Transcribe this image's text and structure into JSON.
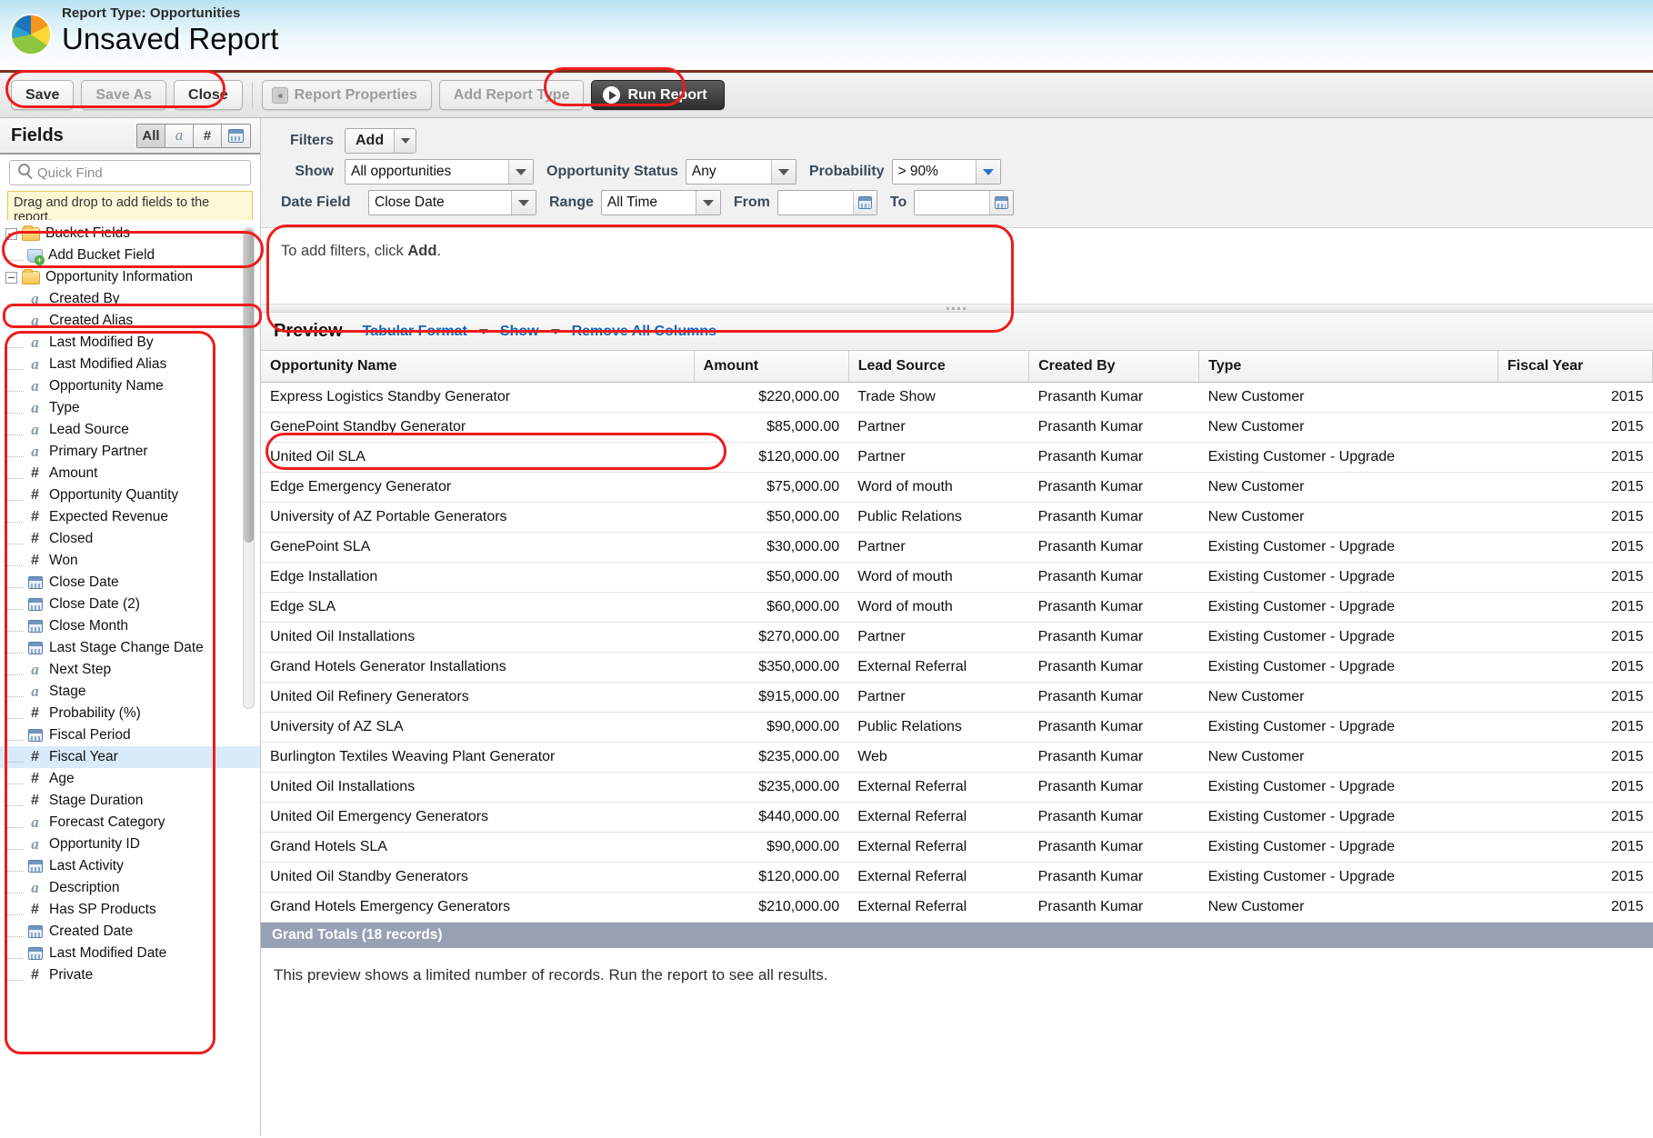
{
  "header": {
    "report_type_label": "Report Type: Opportunities",
    "report_name": "Unsaved Report",
    "logo_icon": "pie-chart-logo"
  },
  "toolbar": {
    "save": "Save",
    "save_as": "Save As",
    "close": "Close",
    "report_properties": "Report Properties",
    "add_report_type": "Add Report Type",
    "run_report": "Run Report"
  },
  "fields_panel": {
    "title": "Fields",
    "type_filters": [
      {
        "name": "all",
        "label": "All",
        "selected": true
      },
      {
        "name": "text",
        "label": "a",
        "selected": false
      },
      {
        "name": "number",
        "label": "#",
        "selected": false
      },
      {
        "name": "date",
        "label": "",
        "selected": false
      }
    ],
    "quick_find_placeholder": "Quick Find",
    "quick_find_value": "",
    "drag_hint": "Drag and drop to add fields to the report.",
    "tree": [
      {
        "type": "group",
        "label": "Bucket Fields",
        "expanded": true
      },
      {
        "type": "bucket",
        "label": "Add Bucket Field"
      },
      {
        "type": "group",
        "label": "Opportunity Information",
        "expanded": true
      },
      {
        "type": "field",
        "icon": "text",
        "label": "Created By"
      },
      {
        "type": "field",
        "icon": "text",
        "label": "Created Alias"
      },
      {
        "type": "field",
        "icon": "text",
        "label": "Last Modified By"
      },
      {
        "type": "field",
        "icon": "text",
        "label": "Last Modified Alias"
      },
      {
        "type": "field",
        "icon": "text",
        "label": "Opportunity Name"
      },
      {
        "type": "field",
        "icon": "text",
        "label": "Type"
      },
      {
        "type": "field",
        "icon": "text",
        "label": "Lead Source"
      },
      {
        "type": "field",
        "icon": "text",
        "label": "Primary Partner"
      },
      {
        "type": "field",
        "icon": "number",
        "label": "Amount"
      },
      {
        "type": "field",
        "icon": "number",
        "label": "Opportunity Quantity"
      },
      {
        "type": "field",
        "icon": "number",
        "label": "Expected Revenue"
      },
      {
        "type": "field",
        "icon": "number",
        "label": "Closed"
      },
      {
        "type": "field",
        "icon": "number",
        "label": "Won"
      },
      {
        "type": "field",
        "icon": "date",
        "label": "Close Date"
      },
      {
        "type": "field",
        "icon": "date",
        "label": "Close Date (2)"
      },
      {
        "type": "field",
        "icon": "date",
        "label": "Close Month"
      },
      {
        "type": "field",
        "icon": "date",
        "label": "Last Stage Change Date"
      },
      {
        "type": "field",
        "icon": "text",
        "label": "Next Step"
      },
      {
        "type": "field",
        "icon": "text",
        "label": "Stage"
      },
      {
        "type": "field",
        "icon": "number",
        "label": "Probability (%)"
      },
      {
        "type": "field",
        "icon": "date",
        "label": "Fiscal Period"
      },
      {
        "type": "field",
        "icon": "number",
        "label": "Fiscal Year",
        "selected": true
      },
      {
        "type": "field",
        "icon": "number",
        "label": "Age"
      },
      {
        "type": "field",
        "icon": "number",
        "label": "Stage Duration"
      },
      {
        "type": "field",
        "icon": "text",
        "label": "Forecast Category"
      },
      {
        "type": "field",
        "icon": "text",
        "label": "Opportunity ID"
      },
      {
        "type": "field",
        "icon": "date",
        "label": "Last Activity"
      },
      {
        "type": "field",
        "icon": "text",
        "label": "Description"
      },
      {
        "type": "field",
        "icon": "number",
        "label": "Has SP Products"
      },
      {
        "type": "field",
        "icon": "date",
        "label": "Created Date"
      },
      {
        "type": "field",
        "icon": "date",
        "label": "Last Modified Date"
      },
      {
        "type": "field",
        "icon": "number",
        "label": "Private"
      }
    ]
  },
  "filters": {
    "filters_label": "Filters",
    "add_button": "Add",
    "show_label": "Show",
    "show_value": "All opportunities",
    "opportunity_status_label": "Opportunity Status",
    "opportunity_status_value": "Any",
    "probability_label": "Probability",
    "probability_value": "> 90%",
    "date_field_label": "Date Field",
    "date_field_value": "Close Date",
    "range_label": "Range",
    "range_value": "All Time",
    "from_label": "From",
    "from_value": "",
    "to_label": "To",
    "to_value": "",
    "empty_note_prefix": "To add filters, click ",
    "empty_note_bold": "Add",
    "empty_note_suffix": "."
  },
  "preview": {
    "title": "Preview",
    "format_link": "Tabular Format",
    "show_link": "Show",
    "remove_all_link": "Remove All Columns",
    "columns": [
      "Opportunity Name",
      "Amount",
      "Lead Source",
      "Created By",
      "Type",
      "Fiscal Year"
    ],
    "rows": [
      [
        "Express Logistics Standby Generator",
        "$220,000.00",
        "Trade Show",
        "Prasanth Kumar",
        "New Customer",
        "2015"
      ],
      [
        "GenePoint Standby Generator",
        "$85,000.00",
        "Partner",
        "Prasanth Kumar",
        "New Customer",
        "2015"
      ],
      [
        "United Oil SLA",
        "$120,000.00",
        "Partner",
        "Prasanth Kumar",
        "Existing Customer - Upgrade",
        "2015"
      ],
      [
        "Edge Emergency Generator",
        "$75,000.00",
        "Word of mouth",
        "Prasanth Kumar",
        "New Customer",
        "2015"
      ],
      [
        "University of AZ Portable Generators",
        "$50,000.00",
        "Public Relations",
        "Prasanth Kumar",
        "New Customer",
        "2015"
      ],
      [
        "GenePoint SLA",
        "$30,000.00",
        "Partner",
        "Prasanth Kumar",
        "Existing Customer - Upgrade",
        "2015"
      ],
      [
        "Edge Installation",
        "$50,000.00",
        "Word of mouth",
        "Prasanth Kumar",
        "Existing Customer - Upgrade",
        "2015"
      ],
      [
        "Edge SLA",
        "$60,000.00",
        "Word of mouth",
        "Prasanth Kumar",
        "Existing Customer - Upgrade",
        "2015"
      ],
      [
        "United Oil Installations",
        "$270,000.00",
        "Partner",
        "Prasanth Kumar",
        "Existing Customer - Upgrade",
        "2015"
      ],
      [
        "Grand Hotels Generator Installations",
        "$350,000.00",
        "External Referral",
        "Prasanth Kumar",
        "Existing Customer - Upgrade",
        "2015"
      ],
      [
        "United Oil Refinery Generators",
        "$915,000.00",
        "Partner",
        "Prasanth Kumar",
        "New Customer",
        "2015"
      ],
      [
        "University of AZ SLA",
        "$90,000.00",
        "Public Relations",
        "Prasanth Kumar",
        "Existing Customer - Upgrade",
        "2015"
      ],
      [
        "Burlington Textiles Weaving Plant Generator",
        "$235,000.00",
        "Web",
        "Prasanth Kumar",
        "New Customer",
        "2015"
      ],
      [
        "United Oil Installations",
        "$235,000.00",
        "External Referral",
        "Prasanth Kumar",
        "Existing Customer - Upgrade",
        "2015"
      ],
      [
        "United Oil Emergency Generators",
        "$440,000.00",
        "External Referral",
        "Prasanth Kumar",
        "Existing Customer - Upgrade",
        "2015"
      ],
      [
        "Grand Hotels SLA",
        "$90,000.00",
        "External Referral",
        "Prasanth Kumar",
        "Existing Customer - Upgrade",
        "2015"
      ],
      [
        "United Oil Standby Generators",
        "$120,000.00",
        "External Referral",
        "Prasanth Kumar",
        "Existing Customer - Upgrade",
        "2015"
      ],
      [
        "Grand Hotels Emergency Generators",
        "$210,000.00",
        "External Referral",
        "Prasanth Kumar",
        "New Customer",
        "2015"
      ]
    ],
    "grand_totals": "Grand Totals (18 records)",
    "footer_note": "This preview shows a limited number of records. Run the report to see all results."
  },
  "colors": {
    "accent_link": "#1664c0",
    "annotation": "#ee1c1c",
    "header_rule": "#7a2f20",
    "totals_bar": "#98a0b4"
  }
}
